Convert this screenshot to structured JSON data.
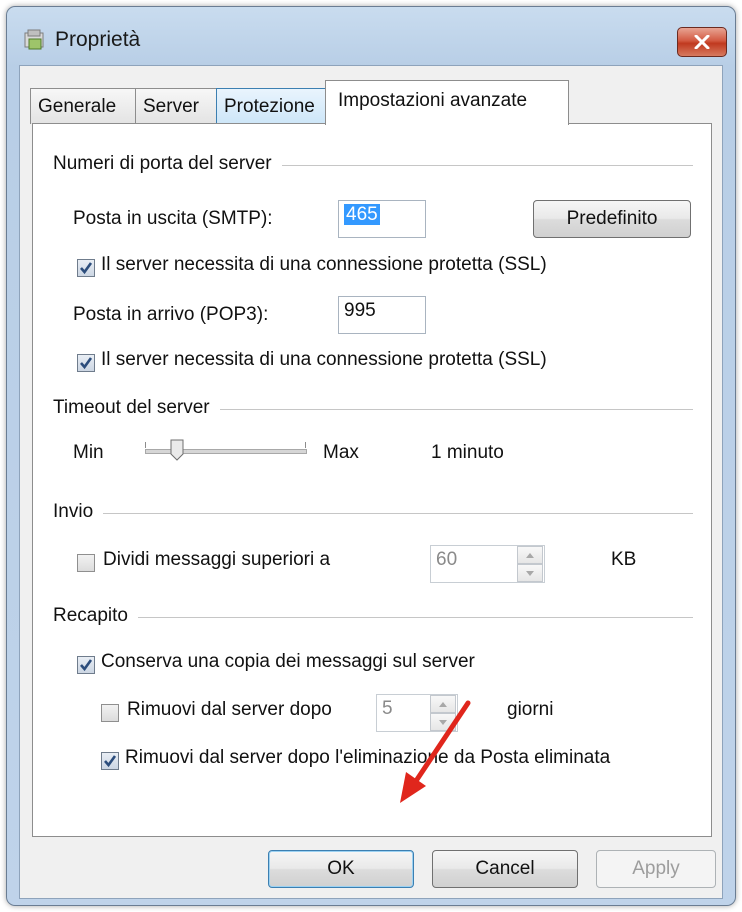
{
  "window": {
    "title": "Proprietà"
  },
  "tabs": [
    {
      "label": "Generale"
    },
    {
      "label": "Server"
    },
    {
      "label": "Protezione"
    },
    {
      "label": "Impostazioni avanzate"
    }
  ],
  "ports": {
    "group_title": "Numeri di porta del server",
    "smtp_label": "Posta in uscita (SMTP):",
    "smtp_value": "465",
    "default_button": "Predefinito",
    "smtp_ssl_label": "Il server necessita di una connessione protetta (SSL)",
    "smtp_ssl_checked": true,
    "pop3_label": "Posta in arrivo (POP3):",
    "pop3_value": "995",
    "pop3_ssl_label": "Il server necessita di una connessione protetta (SSL)",
    "pop3_ssl_checked": true
  },
  "timeout": {
    "group_title": "Timeout del server",
    "min_label": "Min",
    "max_label": "Max",
    "value_label": "1 minuto",
    "slider_fraction": 0.2
  },
  "send": {
    "group_title": "Invio",
    "split_label": "Dividi messaggi superiori a",
    "split_checked": false,
    "split_value": "60",
    "unit": "KB"
  },
  "delivery": {
    "group_title": "Recapito",
    "keep_copy_label": "Conserva una copia dei messaggi sul server",
    "keep_copy_checked": true,
    "remove_after_label": "Rimuovi dal server dopo",
    "remove_after_checked": false,
    "remove_after_value": "5",
    "days_label": "giorni",
    "remove_on_delete_label": "Rimuovi dal server dopo l'eliminazione da Posta eliminata",
    "remove_on_delete_checked": true
  },
  "buttons": {
    "ok": "OK",
    "cancel": "Cancel",
    "apply": "Apply"
  },
  "colors": {
    "annotation_arrow": "#e0261c",
    "selection": "#3399ff"
  }
}
